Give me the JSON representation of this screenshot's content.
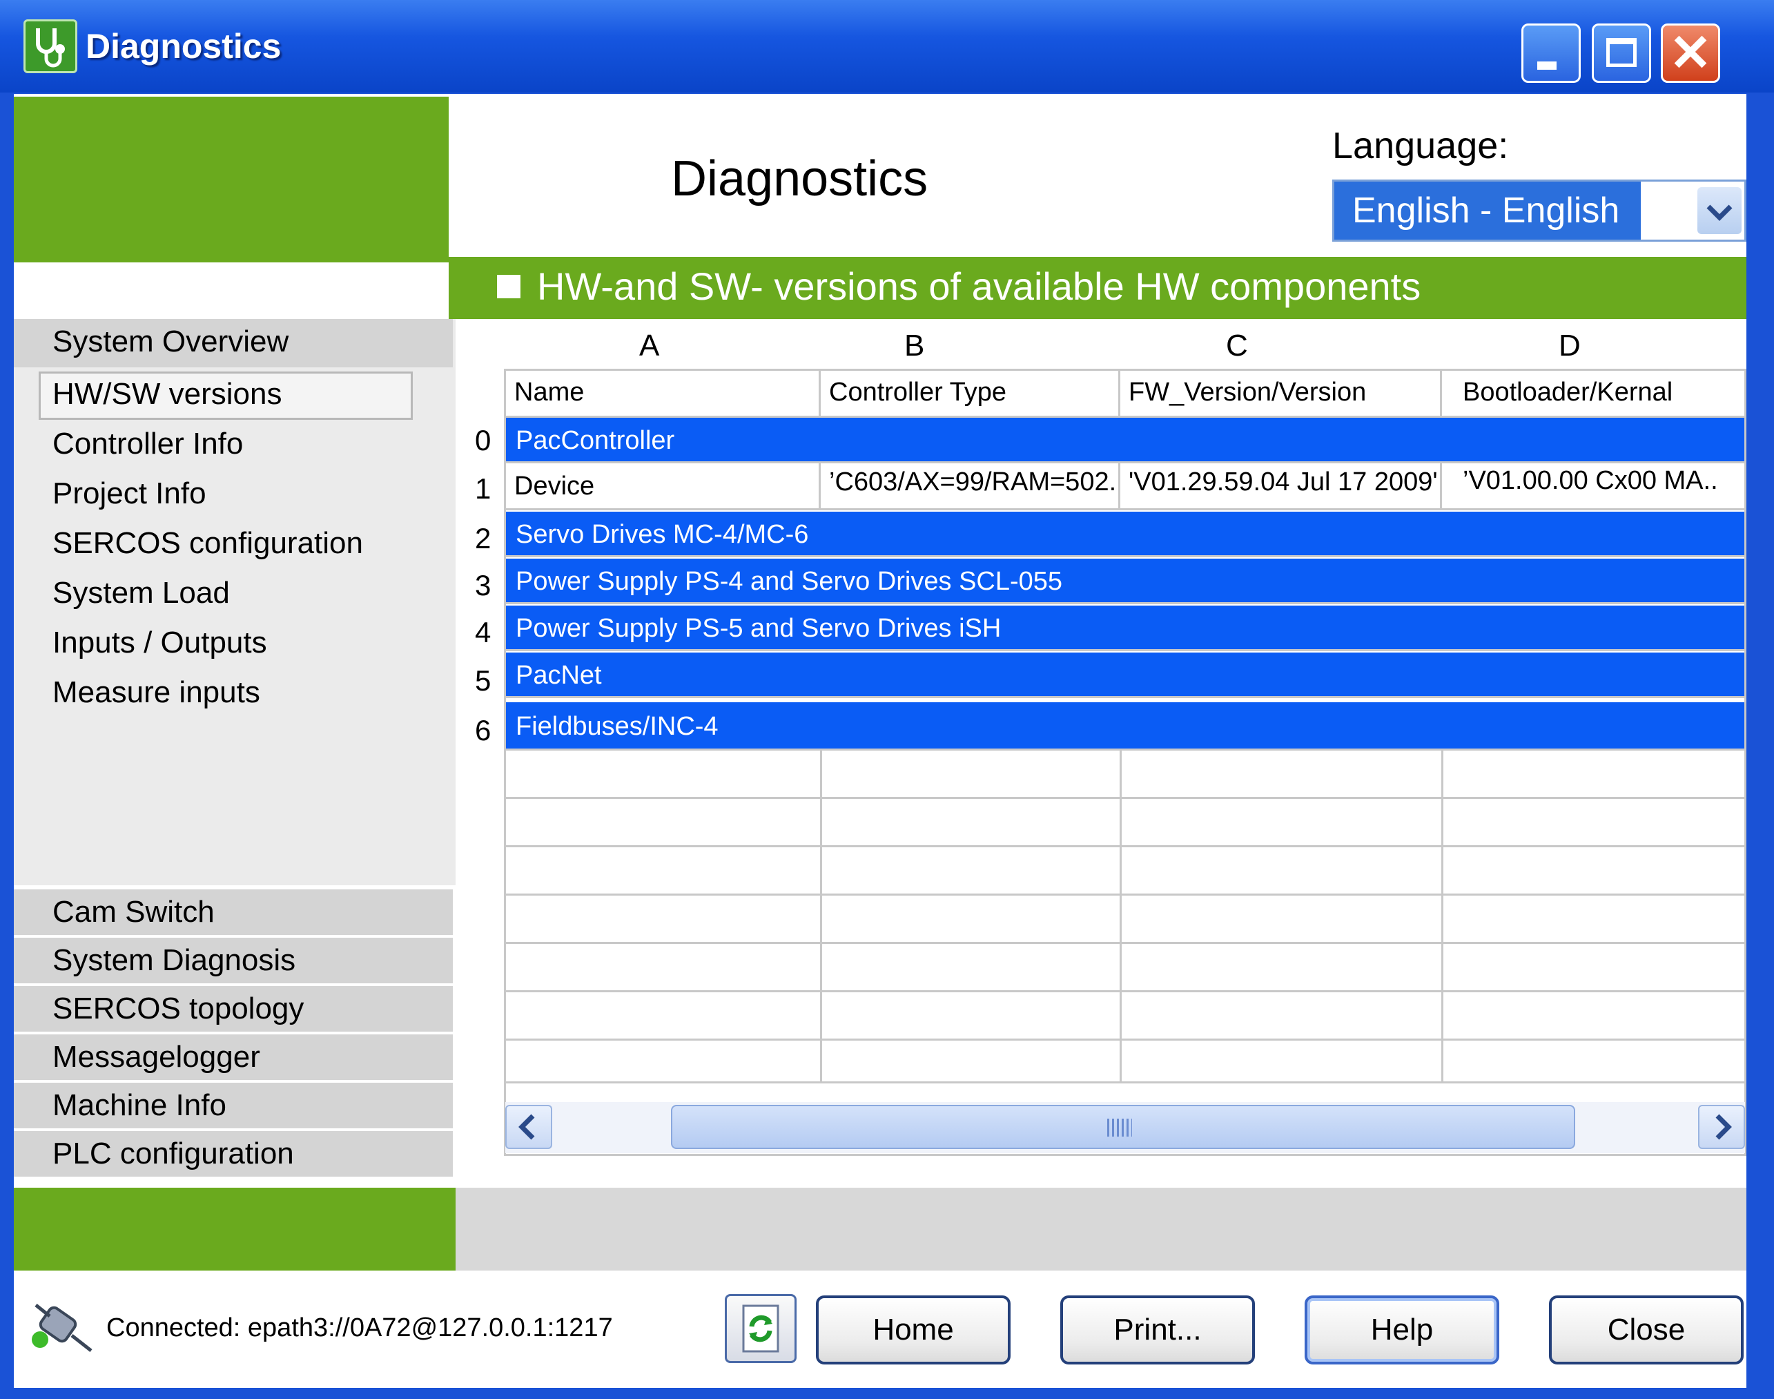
{
  "window": {
    "title": "Diagnostics",
    "icon": "stethoscope-icon"
  },
  "header": {
    "title": "Diagnostics",
    "language_label": "Language:",
    "language_value": "English - English"
  },
  "section": {
    "title": "HW-and SW- versions of available HW components"
  },
  "sidebar": {
    "header": "System Overview",
    "items": [
      {
        "label": "HW/SW versions",
        "selected": true
      },
      {
        "label": "Controller Info"
      },
      {
        "label": "Project Info"
      },
      {
        "label": "SERCOS configuration"
      },
      {
        "label": "System Load"
      },
      {
        "label": "Inputs / Outputs"
      },
      {
        "label": "Measure inputs"
      }
    ],
    "bottom_items": [
      {
        "label": "Cam Switch"
      },
      {
        "label": "System Diagnosis"
      },
      {
        "label": "SERCOS topology"
      },
      {
        "label": "Messagelogger"
      },
      {
        "label": "Machine Info"
      },
      {
        "label": "PLC configuration"
      }
    ]
  },
  "table": {
    "column_letters": [
      "A",
      "B",
      "C",
      "D"
    ],
    "headers": [
      "Name",
      "Controller Type",
      "FW_Version/Version",
      "Bootloader/Kernal"
    ],
    "row_numbers": [
      "0",
      "1",
      "2",
      "3",
      "4",
      "5",
      "6"
    ],
    "rows": [
      {
        "type": "group",
        "label": "PacController"
      },
      {
        "type": "data",
        "cells": [
          "Device",
          "’C603/AX=99/RAM=502..",
          "'V01.29.59.04 Jul 17 2009'",
          "’V01.00.00 Cx00 MA.."
        ]
      },
      {
        "type": "group",
        "label": "Servo Drives MC-4/MC-6"
      },
      {
        "type": "group",
        "label": "Power Supply PS-4 and Servo Drives SCL-055"
      },
      {
        "type": "group",
        "label": "Power Supply PS-5 and Servo Drives iSH"
      },
      {
        "type": "group",
        "label": "PacNet"
      },
      {
        "type": "group",
        "label": "Fieldbuses/INC-4"
      }
    ]
  },
  "status": {
    "connection": "Connected: epath3://0A72@127.0.0.1:1217"
  },
  "buttons": {
    "home": "Home",
    "print": "Print...",
    "help": "Help",
    "close": "Close"
  },
  "colors": {
    "accent_green": "#6aaa1e",
    "row_blue": "#0a5cf5",
    "titlebar_blue": "#1656e0"
  }
}
